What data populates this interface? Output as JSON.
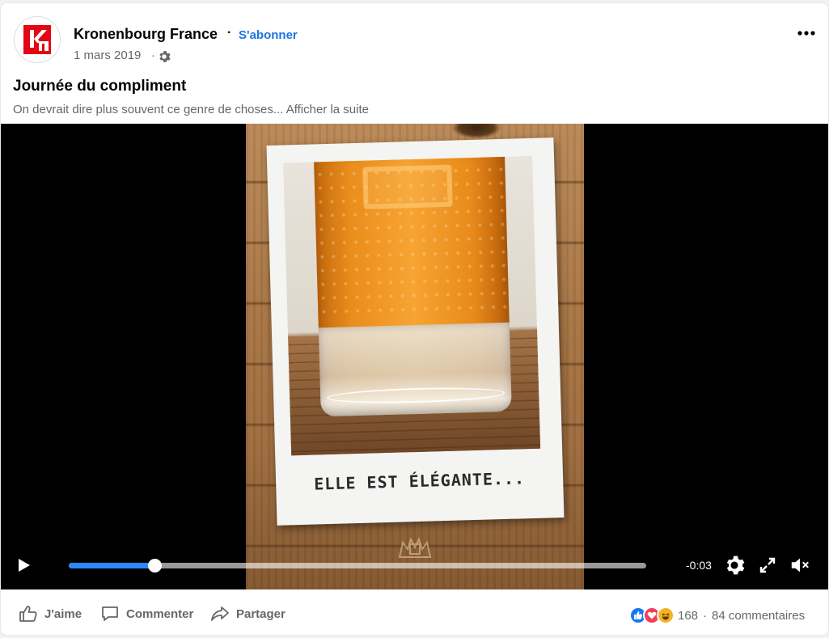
{
  "post": {
    "page_name": "Kronenbourg France",
    "separator": "·",
    "follow_label": "S'abonner",
    "date": "1 mars 2019",
    "date_separator": "·",
    "privacy_icon": "gear-icon",
    "title": "Journée du compliment",
    "text": "On devrait dire plus souvent ce genre de choses...",
    "see_more": "Afficher la suite"
  },
  "video": {
    "caption": "ELLE EST ÉLÉGANTE...",
    "progress": 0.149,
    "time_remaining": "-0:03",
    "controls": [
      "play-icon",
      "settings-icon",
      "fullscreen-icon",
      "mute-icon"
    ]
  },
  "footer": {
    "like_label": "J'aime",
    "comment_label": "Commenter",
    "share_label": "Partager",
    "reaction_count": "168",
    "separator": "·",
    "comments": "84 commentaires"
  },
  "colors": {
    "accent": "#1b74e4",
    "progress": "#2d88ff",
    "muted_text": "#65676b",
    "brand_red": "#e30613"
  }
}
